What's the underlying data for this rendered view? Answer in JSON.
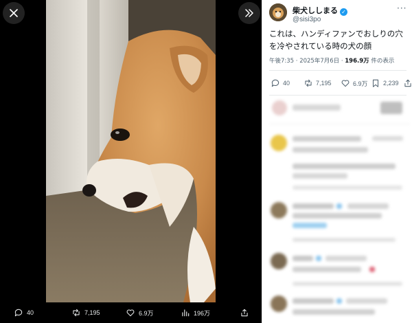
{
  "viewer": {
    "close_icon": "close-icon",
    "expand_icon": "expand-icon",
    "media_description": "",
    "actions": {
      "replies": "40",
      "retweets": "7,195",
      "likes": "6.9万",
      "views": "196万"
    }
  },
  "tweet": {
    "author_name": "柴犬ししまる",
    "author_handle": "@sisi3po",
    "text": "これは、ハンディファンでおしりの穴を冷やされている時の犬の顔",
    "time": "午後7:35 · 2025年7月6日 · ",
    "views_count": "196.9万",
    "views_label": " 件の表示",
    "stats": {
      "replies": "40",
      "retweets": "7,195",
      "likes": "6.9万",
      "bookmarks": "2,239"
    }
  },
  "colors": {
    "accent": "#1d9bf0",
    "text_primary": "#0f1419",
    "text_secondary": "#536471",
    "viewer_bg": "#000000"
  }
}
